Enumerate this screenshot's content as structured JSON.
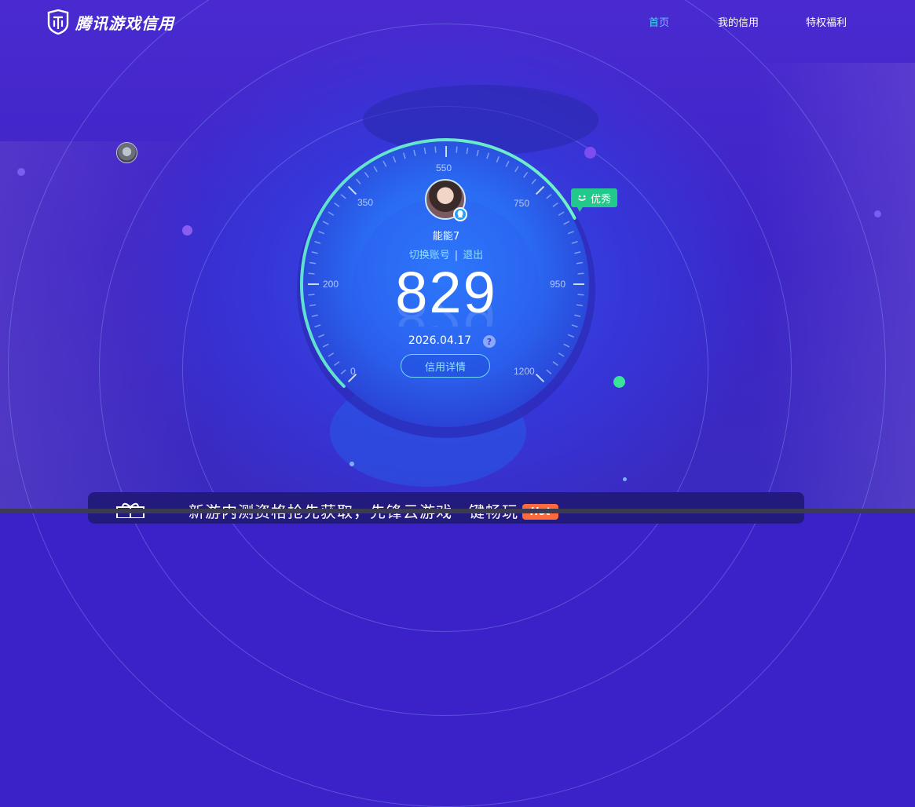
{
  "header": {
    "logo_text": "腾讯游戏信用",
    "nav": [
      {
        "label": "首页",
        "active": true
      },
      {
        "label": "我的信用",
        "active": false
      },
      {
        "label": "特权福利",
        "active": false
      }
    ]
  },
  "gauge": {
    "ticks": [
      "0",
      "200",
      "350",
      "550",
      "750",
      "950",
      "1200"
    ],
    "rating_badge": "优秀",
    "score": "829"
  },
  "user": {
    "name": "能能7",
    "switch_account": "切换账号",
    "separator": "|",
    "logout": "退出",
    "date": "2026.04.17",
    "help": "?",
    "detail_button": "信用详情"
  },
  "banner": {
    "text": "新游内测资格抢先获取，先锋云游戏一键畅玩",
    "hot": "Hot"
  },
  "colors": {
    "accent": "#4fd3ff",
    "badge": "#23c98b",
    "hot": "#ff6a3d",
    "background": "#3a22c8"
  },
  "icons": [
    "logo-icon",
    "qq-icon",
    "smile-icon",
    "help-icon",
    "gift-icon"
  ]
}
